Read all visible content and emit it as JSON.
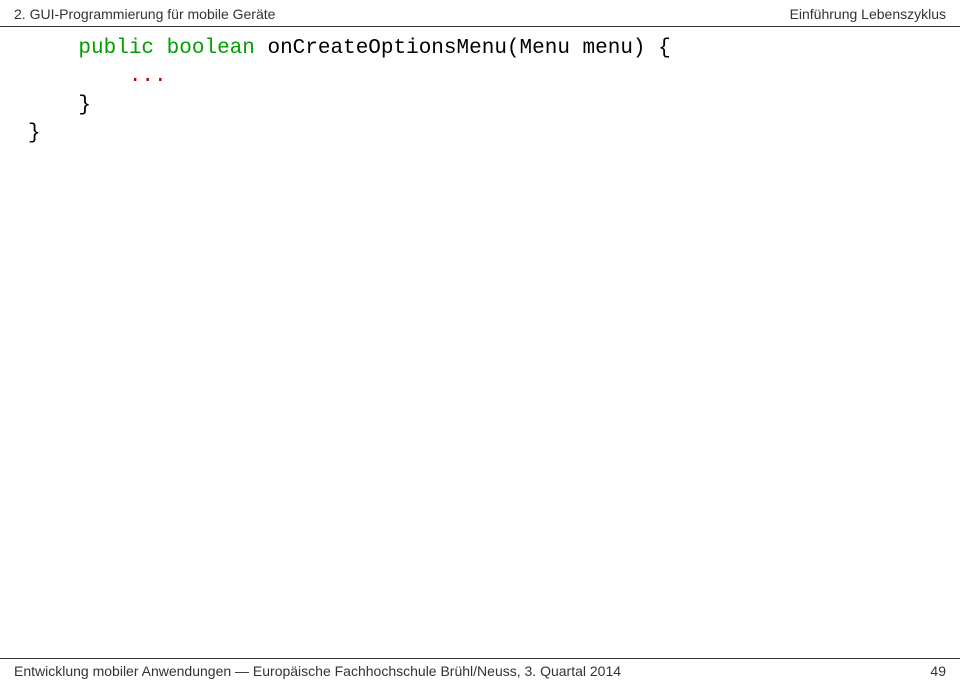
{
  "header": {
    "left": "2. GUI-Programmierung für mobile Geräte",
    "right": "Einführung Lebenszyklus"
  },
  "code": {
    "line1_indent": "    ",
    "line1_kw1": "public",
    "line1_sp1": " ",
    "line1_kw2": "boolean",
    "line1_rest": " onCreateOptionsMenu(Menu menu) {",
    "line2": "        ...",
    "line3": "    }",
    "line4": "}"
  },
  "footer": {
    "text": "Entwicklung mobiler Anwendungen — Europäische Fachhochschule Brühl/Neuss, 3. Quartal 2014",
    "page": "49"
  }
}
